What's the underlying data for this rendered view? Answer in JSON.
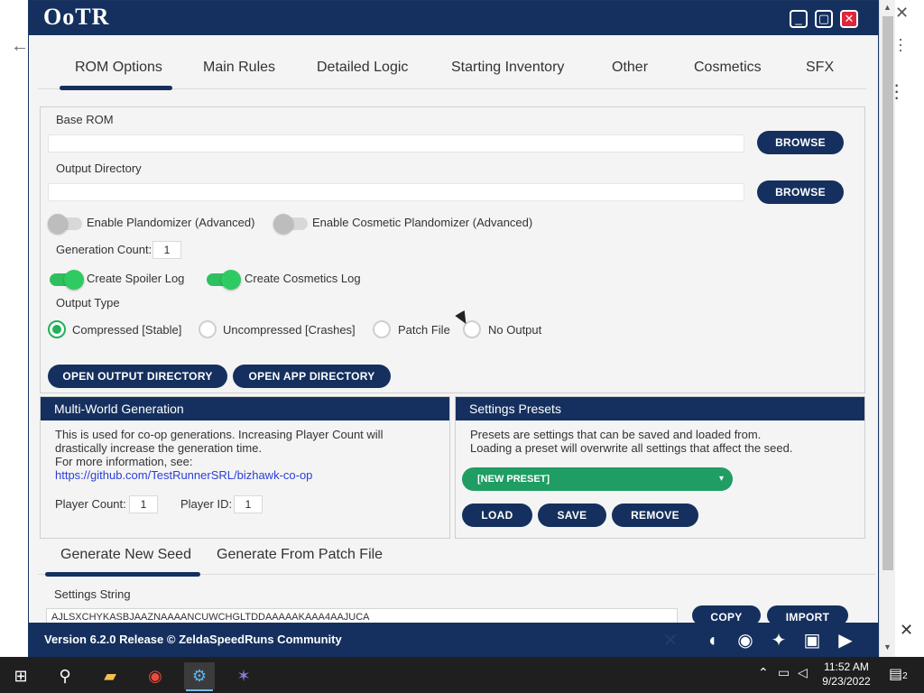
{
  "app": {
    "logo_text": "OoTR",
    "tabs": [
      "ROM Options",
      "Main Rules",
      "Detailed Logic",
      "Starting Inventory",
      "Other",
      "Cosmetics",
      "SFX"
    ],
    "selected_tab": "ROM Options"
  },
  "rom_options": {
    "base_rom_label": "Base ROM",
    "base_rom_value": "",
    "output_dir_label": "Output Directory",
    "output_dir_value": "",
    "browse_label": "BROWSE",
    "plandomizer_label": "Enable Plandomizer (Advanced)",
    "plandomizer_on": false,
    "cosmetic_plandomizer_label": "Enable Cosmetic Plandomizer (Advanced)",
    "cosmetic_plandomizer_on": false,
    "generation_count_label": "Generation Count:",
    "generation_count_value": "1",
    "spoiler_log_label": "Create Spoiler Log",
    "spoiler_log_on": true,
    "cosmetics_log_label": "Create Cosmetics Log",
    "cosmetics_log_on": true,
    "output_type_label": "Output Type",
    "output_types": [
      "Compressed [Stable]",
      "Uncompressed [Crashes]",
      "Patch File",
      "No Output"
    ],
    "selected_output_type": "Compressed [Stable]",
    "open_output_dir_label": "OPEN OUTPUT DIRECTORY",
    "open_app_dir_label": "OPEN APP DIRECTORY"
  },
  "multiworld": {
    "header": "Multi-World Generation",
    "desc_line1": "This is used for co-op generations. Increasing Player Count will",
    "desc_line2": "drastically increase the generation time.",
    "desc_line3": "For more information, see:",
    "link": "https://github.com/TestRunnerSRL/bizhawk-co-op",
    "player_count_label": "Player Count:",
    "player_count_value": "1",
    "player_id_label": "Player ID:",
    "player_id_value": "1"
  },
  "presets": {
    "header": "Settings Presets",
    "desc_line1": "Presets are settings that can be saved and loaded from.",
    "desc_line2": "Loading a preset will overwrite all settings that affect the seed.",
    "selected": "[NEW PRESET]",
    "load_label": "LOAD",
    "save_label": "SAVE",
    "remove_label": "REMOVE"
  },
  "generate": {
    "tabs": [
      "Generate New Seed",
      "Generate From Patch File"
    ],
    "selected_tab": "Generate New Seed",
    "settings_string_label": "Settings String",
    "settings_string_value": "AJLSXCHYKASBJAAZNAAAANCUWCHGLTDDAAAAAKAAA4AAJUCA",
    "copy_label": "COPY",
    "import_label": "IMPORT"
  },
  "footer": {
    "version_prefix": "Version",
    "version": "6.2.0 Release",
    "credit": "© ZeldaSpeedRuns Community"
  },
  "taskbar": {
    "time": "11:52 AM",
    "date": "9/23/2022",
    "notification_count": "2"
  },
  "colors": {
    "navy": "#15305e",
    "green": "#22b05a",
    "close_red": "#e0263a",
    "link_blue": "#2b3fd6"
  }
}
